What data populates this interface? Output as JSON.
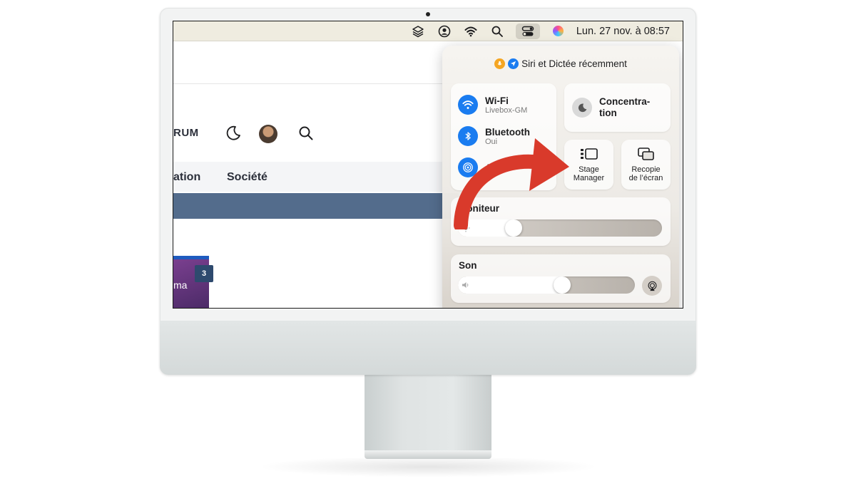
{
  "menubar": {
    "clock": "Lun. 27 nov. à 08:57",
    "icons": [
      "layers-icon",
      "user-circle-icon",
      "wifi-icon",
      "search-icon",
      "control-center-icon",
      "siri-icon"
    ]
  },
  "website": {
    "brand_partial": "RUM",
    "nav_items": [
      "ation",
      "Société"
    ],
    "card_text": "ma",
    "card_badge": "3"
  },
  "control_center": {
    "header": "Siri et Dictée récemment",
    "wifi": {
      "title": "Wi-Fi",
      "sub": "Livebox-GM"
    },
    "bluetooth": {
      "title": "Bluetooth",
      "sub": "Oui"
    },
    "airdrop": {
      "title": "Ai"
    },
    "focus": {
      "label": "Concentra-\ntion"
    },
    "stage_manager": {
      "label_line1": "Stage",
      "label_line2": "Manager"
    },
    "screen_mirroring": {
      "label_line1": "Recopie",
      "label_line2": "de l’écran"
    },
    "display": {
      "title": "Moniteur",
      "level": 0.25
    },
    "sound": {
      "title": "Son",
      "level": 0.6
    }
  },
  "colors": {
    "accent_blue": "#1a7cf0",
    "arrow_red": "#d93a2b",
    "band_blue": "#536c8c"
  }
}
